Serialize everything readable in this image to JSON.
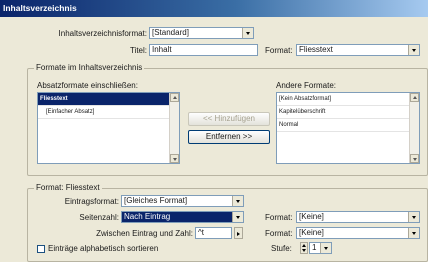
{
  "window": {
    "title": "Inhaltsverzeichnis"
  },
  "top": {
    "format_label": "Inhaltsverzeichnisformat:",
    "format_value": "[Standard]",
    "title_label": "Titel:",
    "title_value": "Inhalt",
    "title_format_label": "Format:",
    "title_format_value": "Fliesstext"
  },
  "group_styles": {
    "title": "Formate im Inhaltsverzeichnis",
    "include_label": "Absatzformate einschließen:",
    "include_items": [
      "Fliesstext",
      "[Einfacher Absatz]"
    ],
    "add_button": "<< Hinzufügen",
    "remove_button": "Entfernen >>",
    "other_label": "Andere Formate:",
    "other_items": [
      "[Kein Absatzformat]",
      "Kapitelüberschrift",
      "Normal"
    ]
  },
  "group_format": {
    "title": "Format: Fliesstext",
    "entry_format_label": "Eintragsformat:",
    "entry_format_value": "[Gleiches Format]",
    "page_number_label": "Seitenzahl:",
    "page_number_value": "Nach Eintrag",
    "page_number_format_label": "Format:",
    "page_number_format_value": "[Keine]",
    "between_label": "Zwischen Eintrag und Zahl:",
    "between_value": "^t",
    "between_format_label": "Format:",
    "between_format_value": "[Keine]",
    "sort_label": "Einträge alphabetisch sortieren",
    "level_label": "Stufe:",
    "level_value": "1"
  }
}
